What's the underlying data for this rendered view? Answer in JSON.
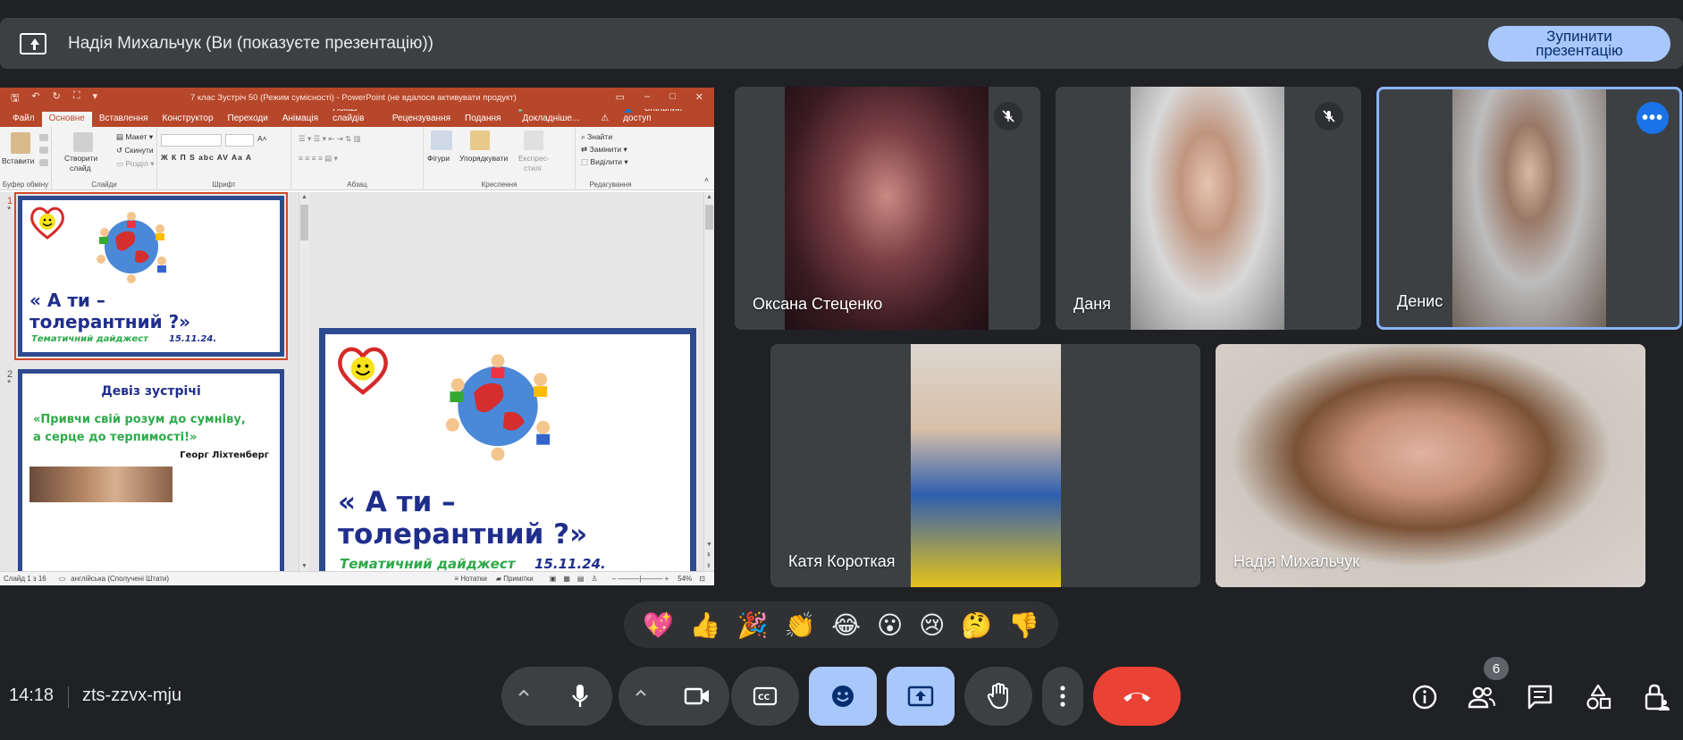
{
  "banner": {
    "title": "Надія Михальчук (Ви (показуєте презентацію))",
    "stop_label_1": "Зупинити",
    "stop_label_2": "презентацію"
  },
  "ppt": {
    "doc_title": "7 клас Зустріч 50 (Режим сумісності) - PowerPoint (не вдалося активувати продукт)",
    "tabs": [
      "Файл",
      "Основне",
      "Вставлення",
      "Конструктор",
      "Переходи",
      "Анімація",
      "Показ слайдів",
      "Рецензування",
      "Подання",
      "Докладніше..."
    ],
    "share": "Спільний доступ",
    "ribbon": {
      "paste": "Вставити",
      "clipboard": "Буфер обміну",
      "create_slide_1": "Створити",
      "create_slide_2": "слайд",
      "layout": "Макет",
      "reset": "Скинути",
      "section": "Розділ",
      "slides": "Слайди",
      "font": "Шрифт",
      "format": "Ж  К  П  S  abc  AV  Aa  A",
      "paragraph": "Абзац",
      "shapes": "Фігури",
      "arrange": "Упорядкувати",
      "quick_1": "Експрес-",
      "quick_2": "стилі",
      "drawing": "Креслення",
      "find": "Знайти",
      "replace": "Замінити",
      "select": "Виділити",
      "editing": "Редагування"
    },
    "slide1": {
      "num": "1",
      "title_1": "« А ти –",
      "title_2": "толерантний ?»",
      "subtitle": "Тематичний дайджест",
      "date": "15.11.24."
    },
    "slide2": {
      "num": "2",
      "heading": "Девіз зустрічі",
      "quote_1": "«Привчи свій розум до сумніву,",
      "quote_2": "а серце до терпимості!»",
      "author": "Георг Ліхтенберг"
    },
    "status": {
      "slide": "Слайд 1 з 16",
      "lang": "англійська (Сполучені Штати)",
      "notes": "Нотатки",
      "comments": "Примітки",
      "zoom": "54%"
    }
  },
  "participants": [
    {
      "name": "Оксана Стеценко",
      "muted": true
    },
    {
      "name": "Даня",
      "muted": true
    },
    {
      "name": "Денис",
      "muted": false
    },
    {
      "name": "Катя Короткая",
      "muted": false
    },
    {
      "name": "Надія Михальчук",
      "muted": false
    }
  ],
  "reactions": [
    "💖",
    "👍",
    "🎉",
    "👏",
    "😂",
    "😮",
    "😢",
    "🤔",
    "👎"
  ],
  "bottom": {
    "time": "14:18",
    "code": "zts-zzvx-mju",
    "participant_count": "6"
  },
  "colors": {
    "accent": "#a8c7fa",
    "end_call": "#ea4335",
    "ppt_brand": "#b7472a"
  }
}
